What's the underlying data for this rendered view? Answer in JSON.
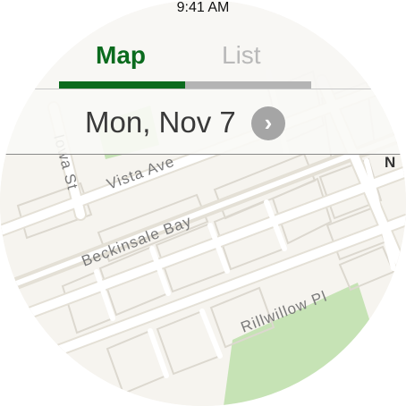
{
  "status": {
    "time": "9:41 AM"
  },
  "tabs": [
    {
      "label": "Map",
      "active": true
    },
    {
      "label": "List",
      "active": false
    }
  ],
  "date_bar": {
    "date": "Mon, Nov 7",
    "next_icon": "chevron-right-icon"
  },
  "map": {
    "streets": [
      "Iowa St",
      "Vista Ave",
      "Beckinsale Bay",
      "Rillwillow Pl"
    ],
    "cut_label": "N"
  },
  "colors": {
    "accent": "#0b6b1e",
    "inactive": "#b4b4b4",
    "park": "#c6e3b5",
    "land": "#f6f4ef"
  }
}
